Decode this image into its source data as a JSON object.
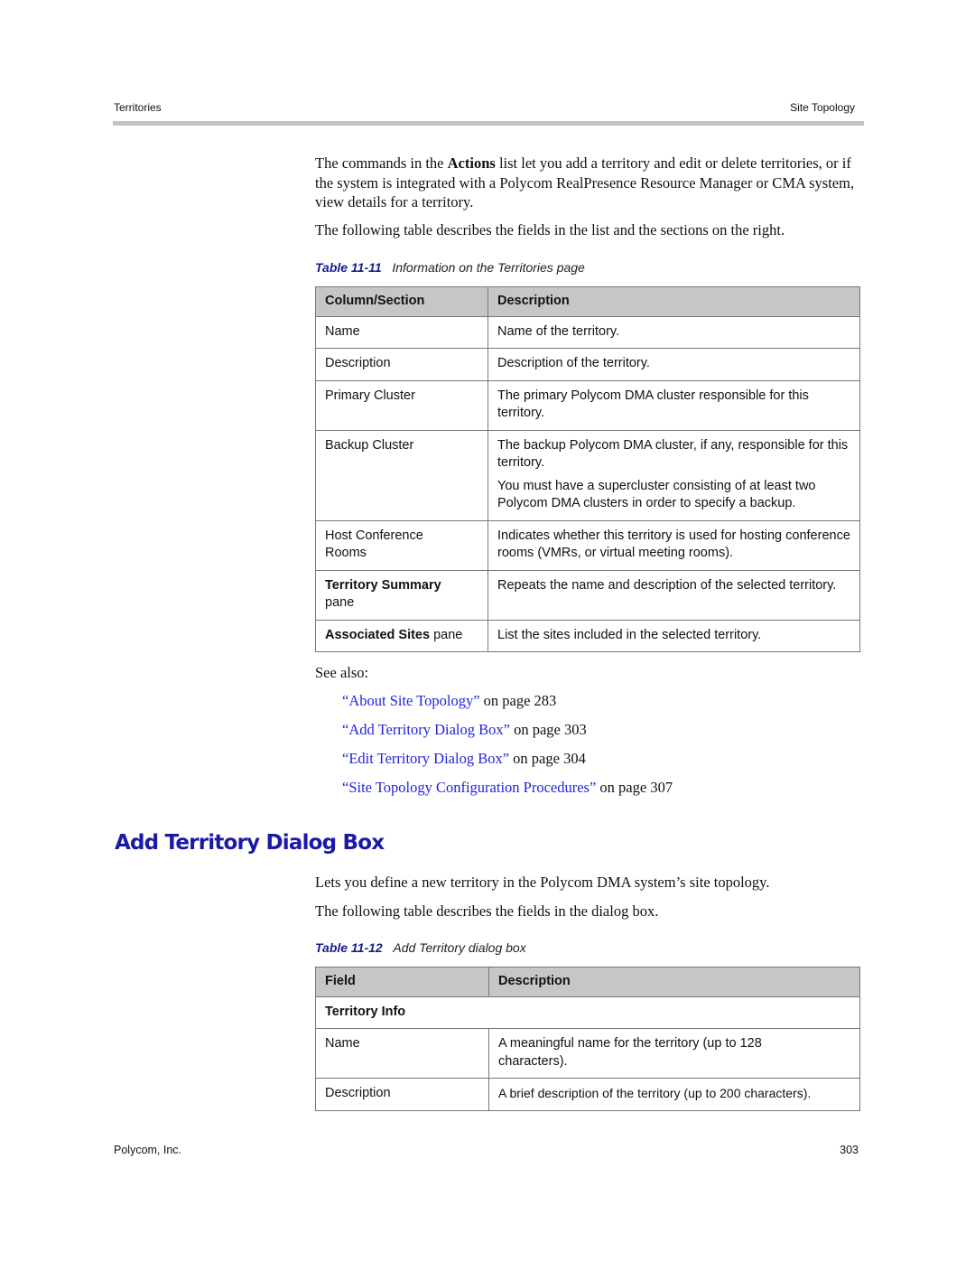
{
  "header": {
    "left": "Territories",
    "right": "Site Topology"
  },
  "intro": {
    "para1_before": "The commands in the ",
    "para1_bold": "Actions",
    "para1_after": " list let you add a territory and edit or delete territories, or if the system is integrated with a Polycom RealPresence Resource Manager or CMA system, view details for a territory.",
    "para2": "The following table describes the fields in the list and the sections on the right."
  },
  "table1": {
    "caption_num": "Table 11-11",
    "caption_text": "Information on the Territories page",
    "headers": [
      "Column/Section",
      "Description"
    ],
    "rows": [
      {
        "col": "Name",
        "desc": [
          "Name of the territory."
        ]
      },
      {
        "col": "Description",
        "desc": [
          "Description of the territory."
        ]
      },
      {
        "col": "Primary Cluster",
        "desc": [
          "The primary Polycom DMA cluster responsible for this territory."
        ]
      },
      {
        "col": "Backup Cluster",
        "desc": [
          "The backup Polycom DMA cluster, if any, responsible for this territory.",
          "You must have a supercluster consisting of at least two Polycom DMA clusters in order to specify a backup."
        ]
      },
      {
        "col": "Host Conference Rooms",
        "desc": [
          "Indicates whether this territory is used for hosting conference rooms (VMRs, or virtual meeting rooms)."
        ]
      },
      {
        "col_bold": "Territory Summary",
        "col_rest": " pane",
        "desc": [
          "Repeats the name and description of the selected territory."
        ]
      },
      {
        "col_bold": "Associated Sites",
        "col_rest": " pane",
        "desc": [
          "List the sites included in the selected territory."
        ]
      }
    ]
  },
  "see_also": {
    "label": "See also:",
    "links": [
      {
        "text": "“About Site Topology”",
        "suffix": " on page 283"
      },
      {
        "text": "“Add Territory Dialog Box”",
        "suffix": " on page 303"
      },
      {
        "text": "“Edit Territory Dialog Box”",
        "suffix": " on page 304"
      },
      {
        "text": "“Site Topology Configuration Procedures”",
        "suffix": " on page 307"
      }
    ]
  },
  "section": {
    "title": "Add Territory Dialog Box",
    "para1": "Lets you define a new territory in the Polycom DMA system’s site topology.",
    "para2": "The following table describes the fields in the dialog box."
  },
  "table2": {
    "caption_num": "Table 11-12",
    "caption_text": "Add Territory dialog box",
    "headers": [
      "Field",
      "Description"
    ],
    "group": "Territory Info",
    "rows": [
      {
        "col": "Name",
        "desc": "A meaningful name for the territory (up to 128 characters)."
      },
      {
        "col": "Description",
        "desc": "A brief description of the territory (up to 200 characters)."
      }
    ]
  },
  "footer": {
    "left": "Polycom, Inc.",
    "right": "303"
  }
}
